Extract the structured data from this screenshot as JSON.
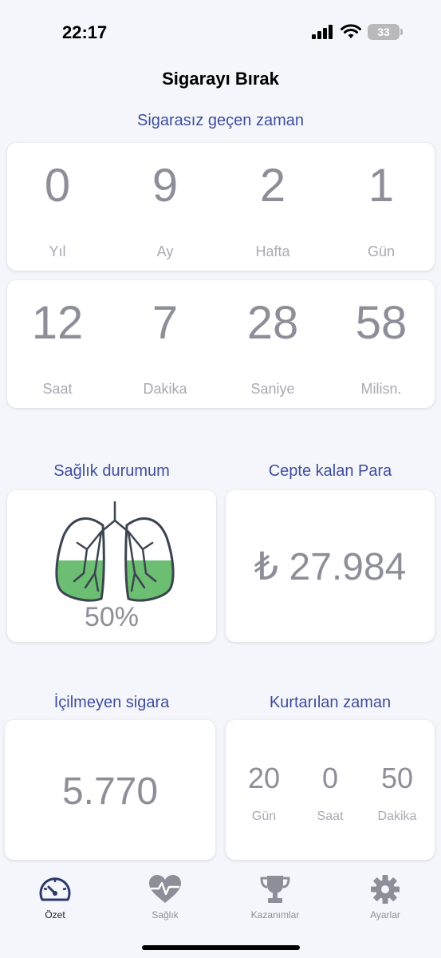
{
  "status": {
    "time": "22:17",
    "battery": "33"
  },
  "app": {
    "title": "Sigarayı Bırak"
  },
  "elapsed": {
    "title": "Sigarasız geçen zaman",
    "row1": [
      {
        "value": "0",
        "label": "Yıl"
      },
      {
        "value": "9",
        "label": "Ay"
      },
      {
        "value": "2",
        "label": "Hafta"
      },
      {
        "value": "1",
        "label": "Gün"
      }
    ],
    "row2": [
      {
        "value": "12",
        "label": "Saat"
      },
      {
        "value": "7",
        "label": "Dakika"
      },
      {
        "value": "28",
        "label": "Saniye"
      },
      {
        "value": "58",
        "label": "Milisn."
      }
    ]
  },
  "health": {
    "title": "Sağlık durumum",
    "percent": "50%",
    "fill_fraction": 0.5,
    "fill_color": "#6cbf72"
  },
  "money": {
    "title": "Cepte kalan Para",
    "value": "₺ 27.984"
  },
  "cigarettes": {
    "title": "İçilmeyen sigara",
    "value": "5.770"
  },
  "saved_time": {
    "title": "Kurtarılan zaman",
    "items": [
      {
        "value": "20",
        "label": "Gün"
      },
      {
        "value": "0",
        "label": "Saat"
      },
      {
        "value": "50",
        "label": "Dakika"
      }
    ]
  },
  "tabs": [
    {
      "label": "Özet",
      "icon": "speedometer-icon"
    },
    {
      "label": "Sağlık",
      "icon": "heart-pulse-icon"
    },
    {
      "label": "Kazanımlar",
      "icon": "trophy-icon"
    },
    {
      "label": "Ayarlar",
      "icon": "gear-icon"
    }
  ],
  "colors": {
    "accent": "#3f4e9c",
    "value_text": "#8e8e99",
    "active_tab": "#2b3a6e"
  }
}
